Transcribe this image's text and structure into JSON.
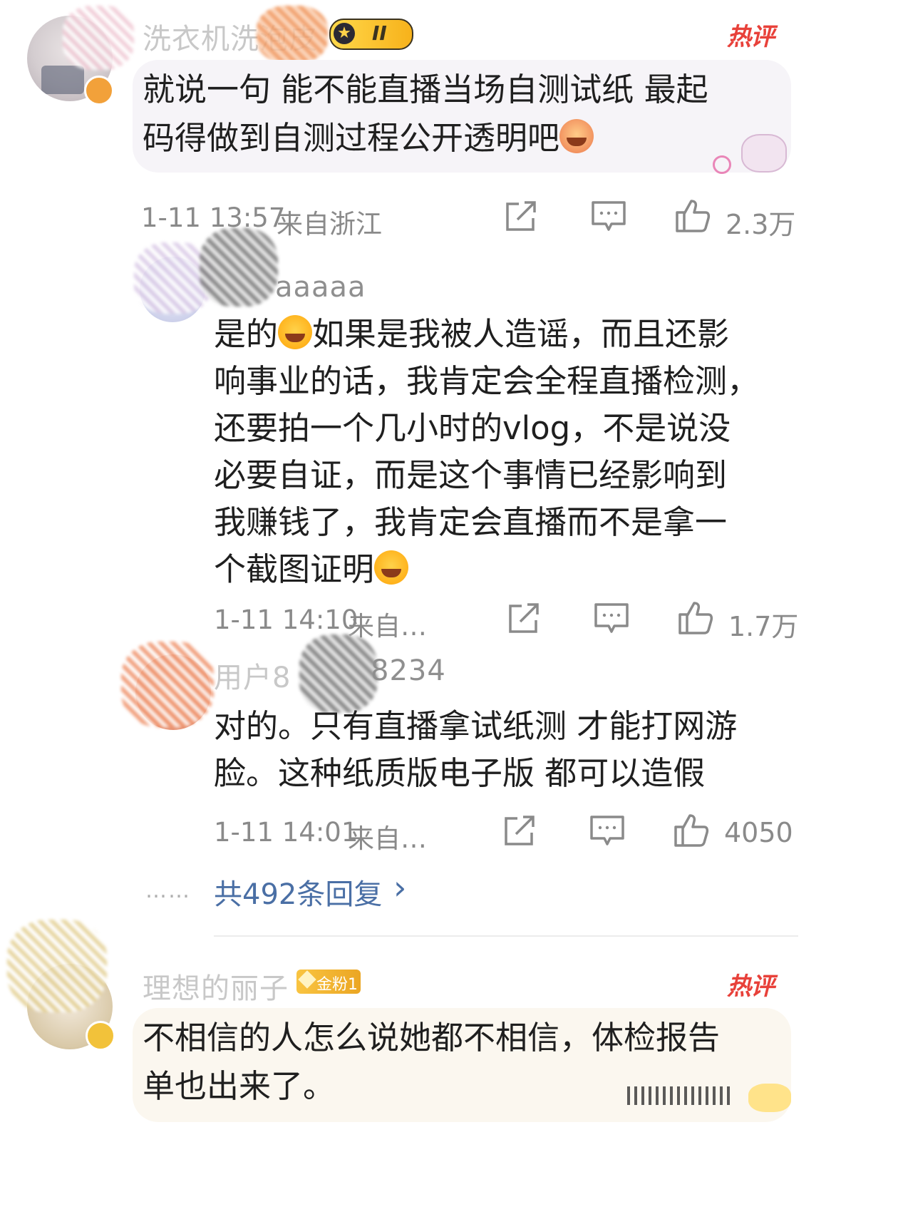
{
  "comments": [
    {
      "username": "洗衣机洗泡皮",
      "level_badge": "II",
      "hot_tag": "热评",
      "text_line1": "就说一句 能不能直播当场自测试纸 最起",
      "text_line2": "码得做到自测过程公开透明吧",
      "time": "1-11 13:57",
      "location": "来自浙江",
      "likes": "2.3万"
    },
    {
      "username": "金粉1",
      "display_name": "理想的丽子",
      "fan_badge": "金粉1",
      "hot_tag": "热评",
      "text_line1": "不相信的人怎么说她都不相信，体检报告",
      "text_line2": "单也出来了。"
    }
  ],
  "replies": [
    {
      "username": "aaaaa",
      "lines": [
        "是的",
        "如果是我被人造谣，而且还影",
        "响事业的话，我肯定会全程直播检测，",
        "还要拍一个几小时的vlog，不是说没",
        "必要自证，而是这个事情已经影响到",
        "我赚钱了，我肯定会直播而不是拿一",
        "个截图证明"
      ],
      "time": "1-11 14:10",
      "location": "来自…",
      "likes": "1.7万"
    },
    {
      "username": "用户8",
      "username_tail": "8234",
      "lines": [
        "对的。只有直播拿试纸测 才能打网游",
        "脸。这种纸质版电子版 都可以造假"
      ],
      "time": "1-11 14:01",
      "location": "来自…",
      "likes": "4050"
    }
  ],
  "more": {
    "dots": "……",
    "label": "共492条回复",
    "chevron": "›"
  },
  "icons": {
    "share": "share-icon",
    "comment": "comment-icon",
    "like": "thumbs-up-icon",
    "emoji": "laughing-emoji-icon"
  },
  "colors": {
    "hot": "#e8413a",
    "link": "#4a6fa5",
    "meta": "#8a8a8a",
    "bubble": "#f6f4f8"
  }
}
